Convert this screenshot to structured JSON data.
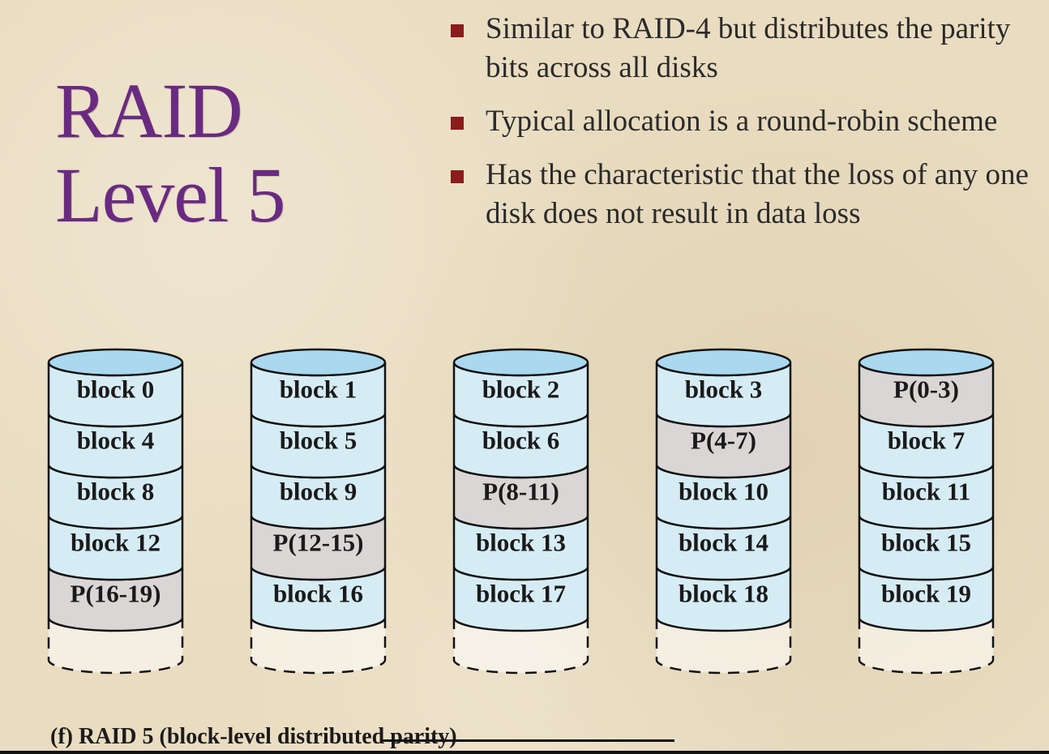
{
  "slide": {
    "title_line1": "RAID",
    "title_line2": "Level 5",
    "bullets": [
      "Similar to RAID-4 but distributes the parity bits across all disks",
      "Typical allocation is a round-robin scheme",
      "Has the characteristic that the loss of any one disk does not result in data loss"
    ],
    "caption": "(f) RAID 5 (block-level distributed parity)"
  },
  "diagram": {
    "colors": {
      "block_fill": "#d6ecf5",
      "parity_fill": "#d9d6d5",
      "cap_fill": "#a9d8ef",
      "outline": "#111111"
    },
    "disks": [
      {
        "blocks": [
          {
            "label": "block 0",
            "parity": false
          },
          {
            "label": "block 4",
            "parity": false
          },
          {
            "label": "block 8",
            "parity": false
          },
          {
            "label": "block 12",
            "parity": false
          },
          {
            "label": "P(16-19)",
            "parity": true
          }
        ]
      },
      {
        "blocks": [
          {
            "label": "block 1",
            "parity": false
          },
          {
            "label": "block 5",
            "parity": false
          },
          {
            "label": "block 9",
            "parity": false
          },
          {
            "label": "P(12-15)",
            "parity": true
          },
          {
            "label": "block 16",
            "parity": false
          }
        ]
      },
      {
        "blocks": [
          {
            "label": "block 2",
            "parity": false
          },
          {
            "label": "block 6",
            "parity": false
          },
          {
            "label": "P(8-11)",
            "parity": true
          },
          {
            "label": "block 13",
            "parity": false
          },
          {
            "label": "block 17",
            "parity": false
          }
        ]
      },
      {
        "blocks": [
          {
            "label": "block 3",
            "parity": false
          },
          {
            "label": "P(4-7)",
            "parity": true
          },
          {
            "label": "block 10",
            "parity": false
          },
          {
            "label": "block 14",
            "parity": false
          },
          {
            "label": "block 18",
            "parity": false
          }
        ]
      },
      {
        "blocks": [
          {
            "label": "P(0-3)",
            "parity": true
          },
          {
            "label": "block 7",
            "parity": false
          },
          {
            "label": "block 11",
            "parity": false
          },
          {
            "label": "block 15",
            "parity": false
          },
          {
            "label": "block 19",
            "parity": false
          }
        ]
      }
    ]
  }
}
